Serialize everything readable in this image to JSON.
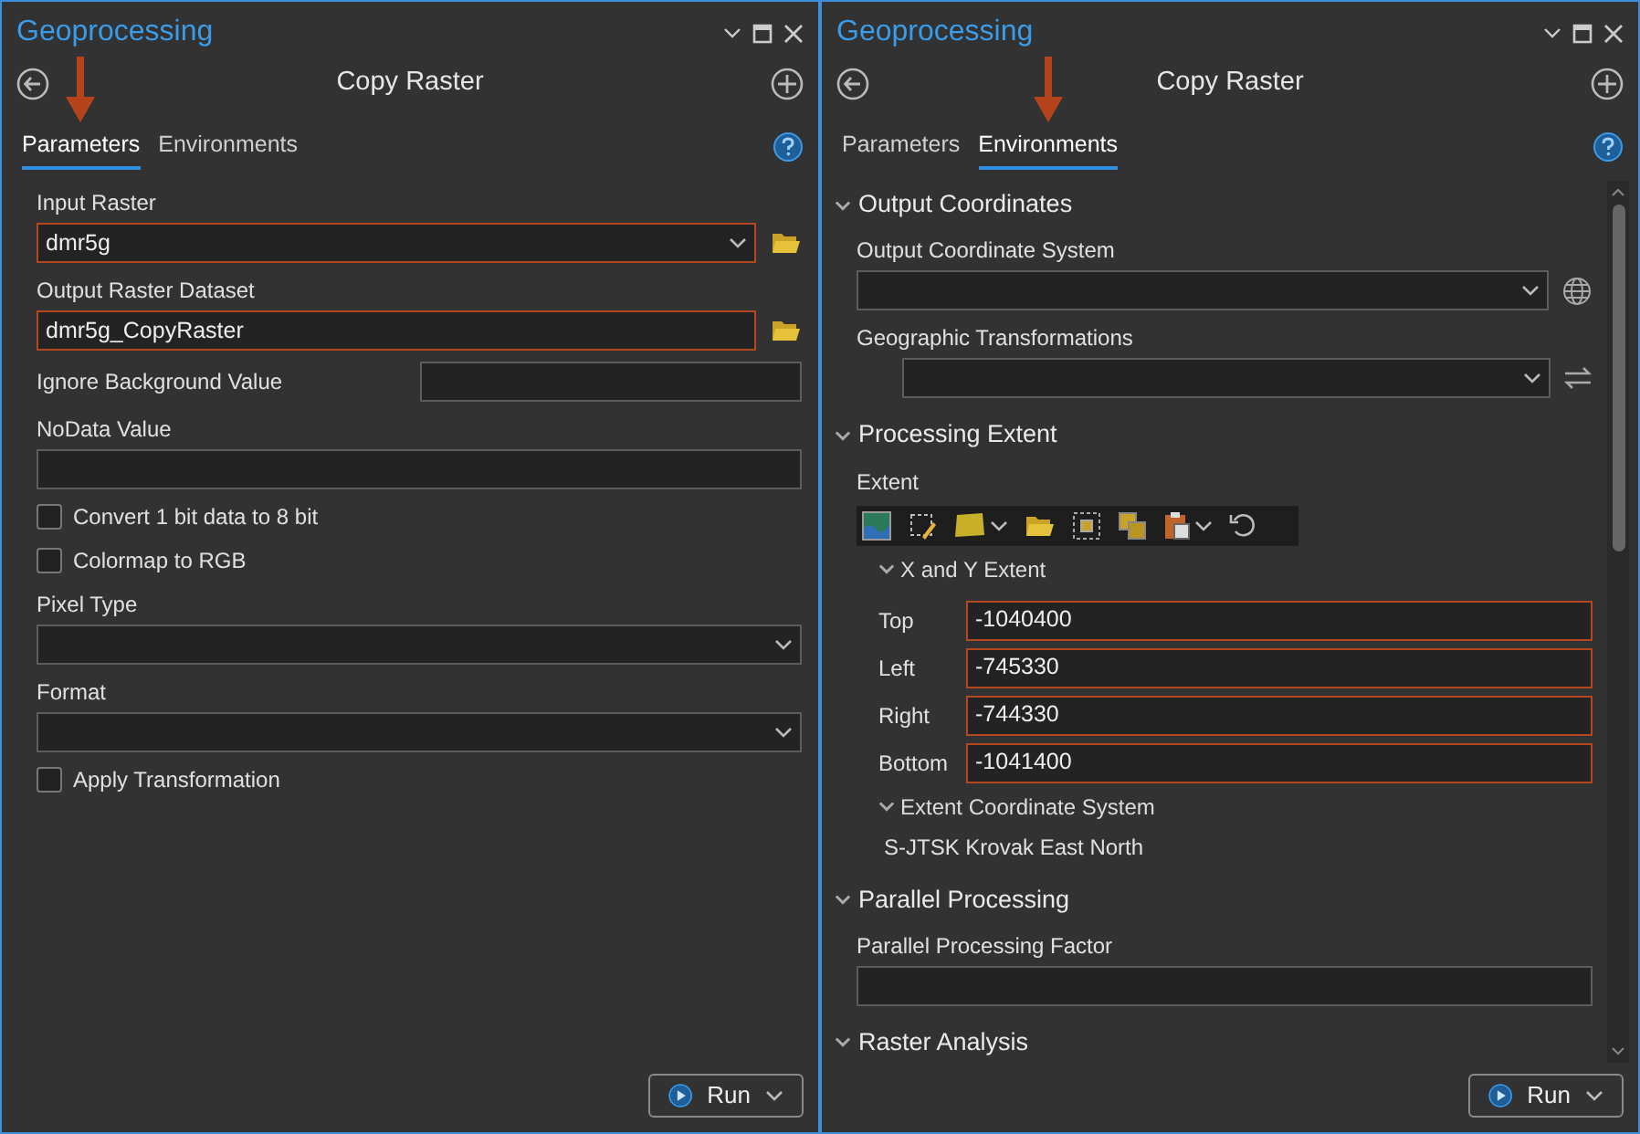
{
  "panels": [
    {
      "title": "Geoprocessing",
      "tool": "Copy Raster",
      "tabs": [
        {
          "label": "Parameters",
          "selected": true
        },
        {
          "label": "Environments",
          "selected": false
        }
      ],
      "items": [
        {
          "kind": "dropdown",
          "label": "Input Raster",
          "value": "dmr5g",
          "warning": true,
          "browse": true
        },
        {
          "kind": "text",
          "label": "Output Raster Dataset",
          "value": "dmr5g_CopyRaster",
          "warning": true,
          "browse": true
        },
        {
          "kind": "inline_text",
          "label": "Ignore Background Value"
        },
        {
          "kind": "text",
          "label": "NoData Value",
          "warning": false,
          "browse": false
        },
        {
          "kind": "checkbox",
          "label": "Convert 1 bit data to 8 bit",
          "checked": false
        },
        {
          "kind": "checkbox",
          "label": "Colormap to RGB",
          "checked": false
        },
        {
          "kind": "dropdown",
          "label": "Pixel Type",
          "warning": false,
          "browse": false
        },
        {
          "kind": "dropdown",
          "label": "Format",
          "warning": false,
          "browse": false
        },
        {
          "kind": "checkbox",
          "label": "Apply Transformation",
          "checked": false
        }
      ],
      "run": "Run"
    },
    {
      "title": "Geoprocessing",
      "tool": "Copy Raster",
      "tabs": [
        {
          "label": "Parameters",
          "selected": false
        },
        {
          "label": "Environments",
          "selected": true
        }
      ],
      "sections": [
        {
          "title": "Output Coordinates",
          "expanded": true,
          "items": [
            {
              "kind": "coord_system",
              "label": "Output Coordinate System"
            },
            {
              "kind": "transformations",
              "label": "Geographic Transformations"
            }
          ]
        },
        {
          "title": "Processing Extent",
          "expanded": true,
          "items": [
            {
              "kind": "extent",
              "label": "Extent",
              "subsections": [
                {
                  "title": "X and Y Extent",
                  "expanded": true,
                  "fields": [
                    {
                      "label": "Top",
                      "value": "-1040400",
                      "warning": true
                    },
                    {
                      "label": "Left",
                      "value": "-745330",
                      "warning": true
                    },
                    {
                      "label": "Right",
                      "value": "-744330",
                      "warning": true
                    },
                    {
                      "label": "Bottom",
                      "value": "-1041400",
                      "warning": true
                    }
                  ]
                },
                {
                  "title": "Extent Coordinate System",
                  "expanded": true,
                  "text": "S-JTSK Krovak East North"
                }
              ]
            }
          ]
        },
        {
          "title": "Parallel Processing",
          "expanded": true,
          "items": [
            {
              "kind": "text",
              "label": "Parallel Processing Factor"
            }
          ]
        },
        {
          "title": "Raster Analysis",
          "expanded": true
        }
      ],
      "run": "Run"
    }
  ]
}
